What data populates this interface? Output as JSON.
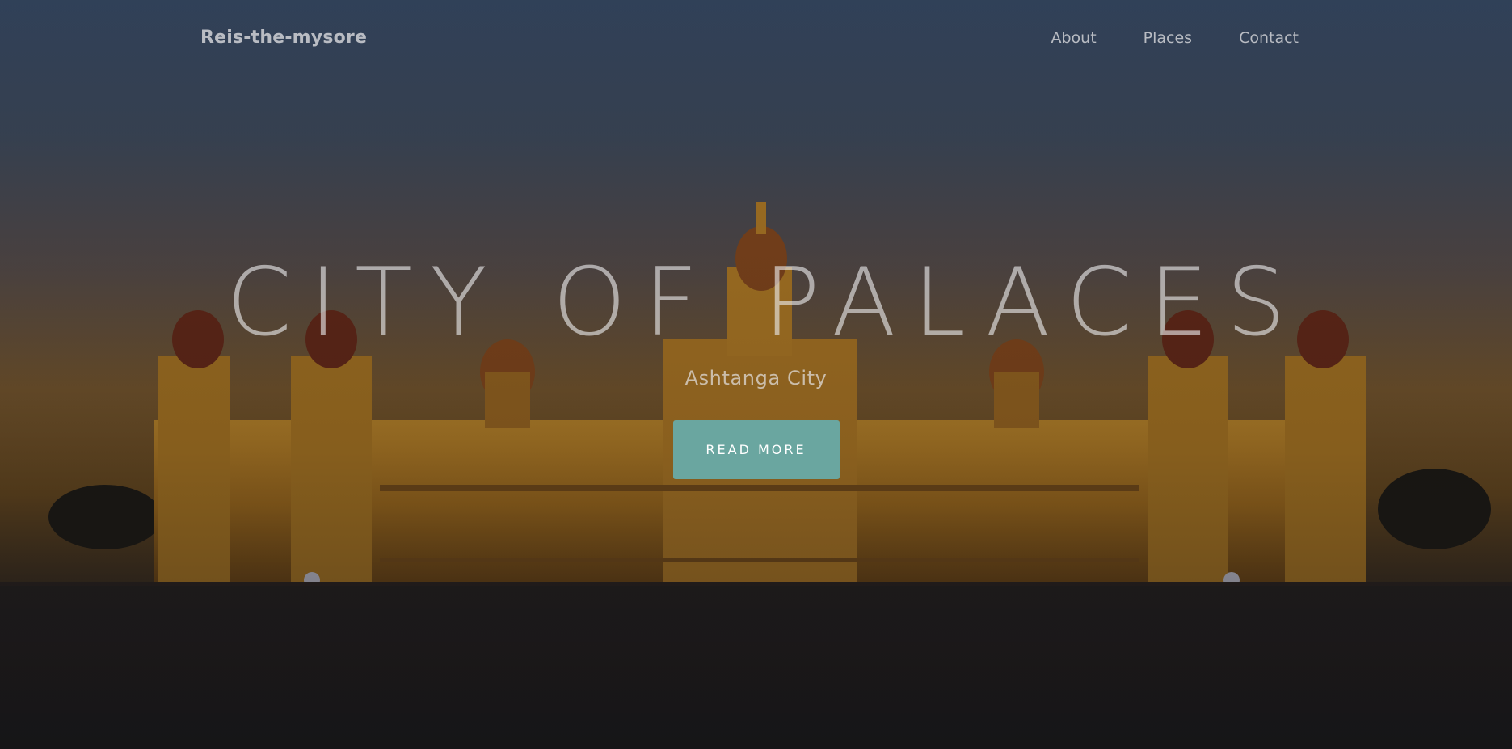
{
  "header": {
    "brand": "Reis-the-mysore",
    "nav": [
      {
        "label": "About"
      },
      {
        "label": "Places"
      },
      {
        "label": "Contact"
      }
    ]
  },
  "hero": {
    "title": "CITY OF PALACES",
    "subtitle": "Ashtanga City",
    "cta_label": "READ MORE",
    "background": "mysore-palace-illuminated-at-dusk",
    "accent_color": "#6aa6a0"
  }
}
